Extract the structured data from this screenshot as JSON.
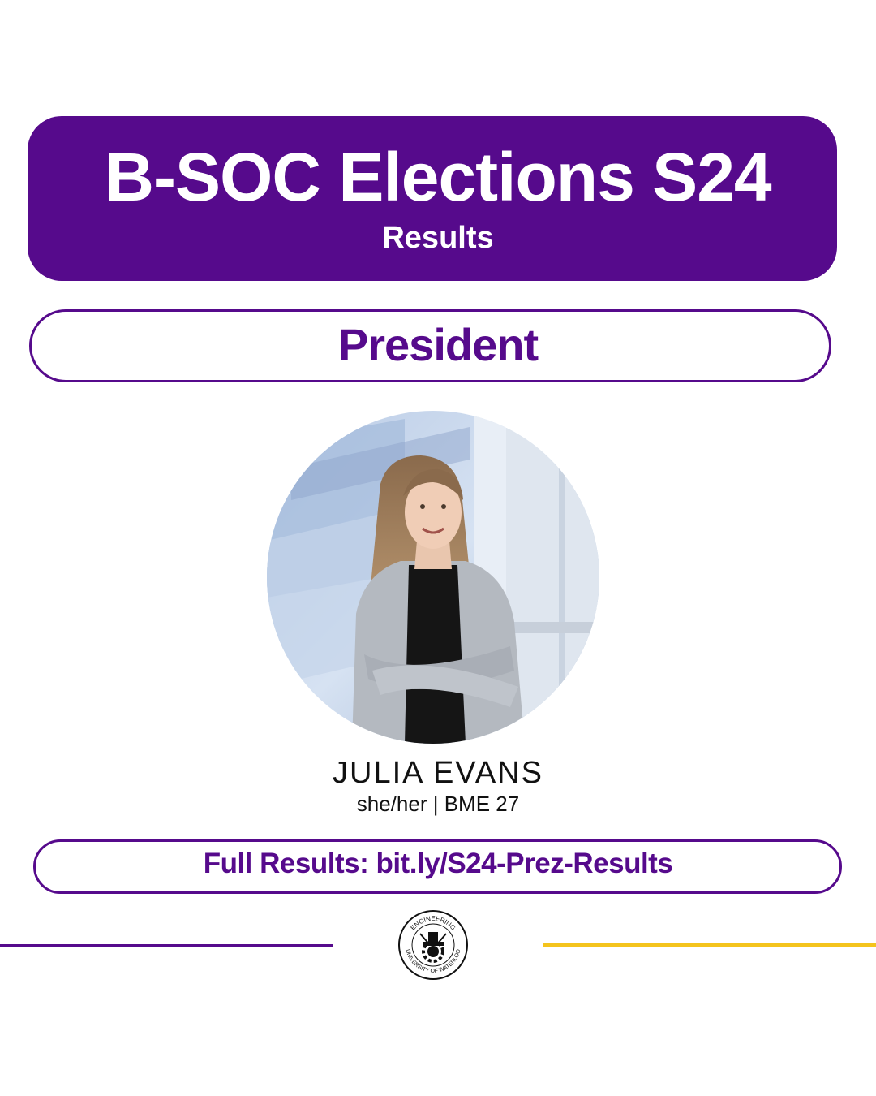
{
  "header": {
    "title": "B-SOC Elections S24",
    "subtitle": "Results"
  },
  "position": {
    "label": "President"
  },
  "candidate": {
    "photo_icon": "candidate-photo",
    "name": "JULIA EVANS",
    "info": "she/her | BME 27"
  },
  "results": {
    "label": "Full Results: bit.ly/S24-Prez-Results"
  },
  "seal": {
    "icon": "engineering-seal-icon",
    "text_top": "ENGINEERING",
    "text_bottom": "UNIVERSITY OF WATERLOO"
  },
  "colors": {
    "primary_purple": "#560a8c",
    "accent_gold": "#f4c41d",
    "background": "#ffffff"
  }
}
